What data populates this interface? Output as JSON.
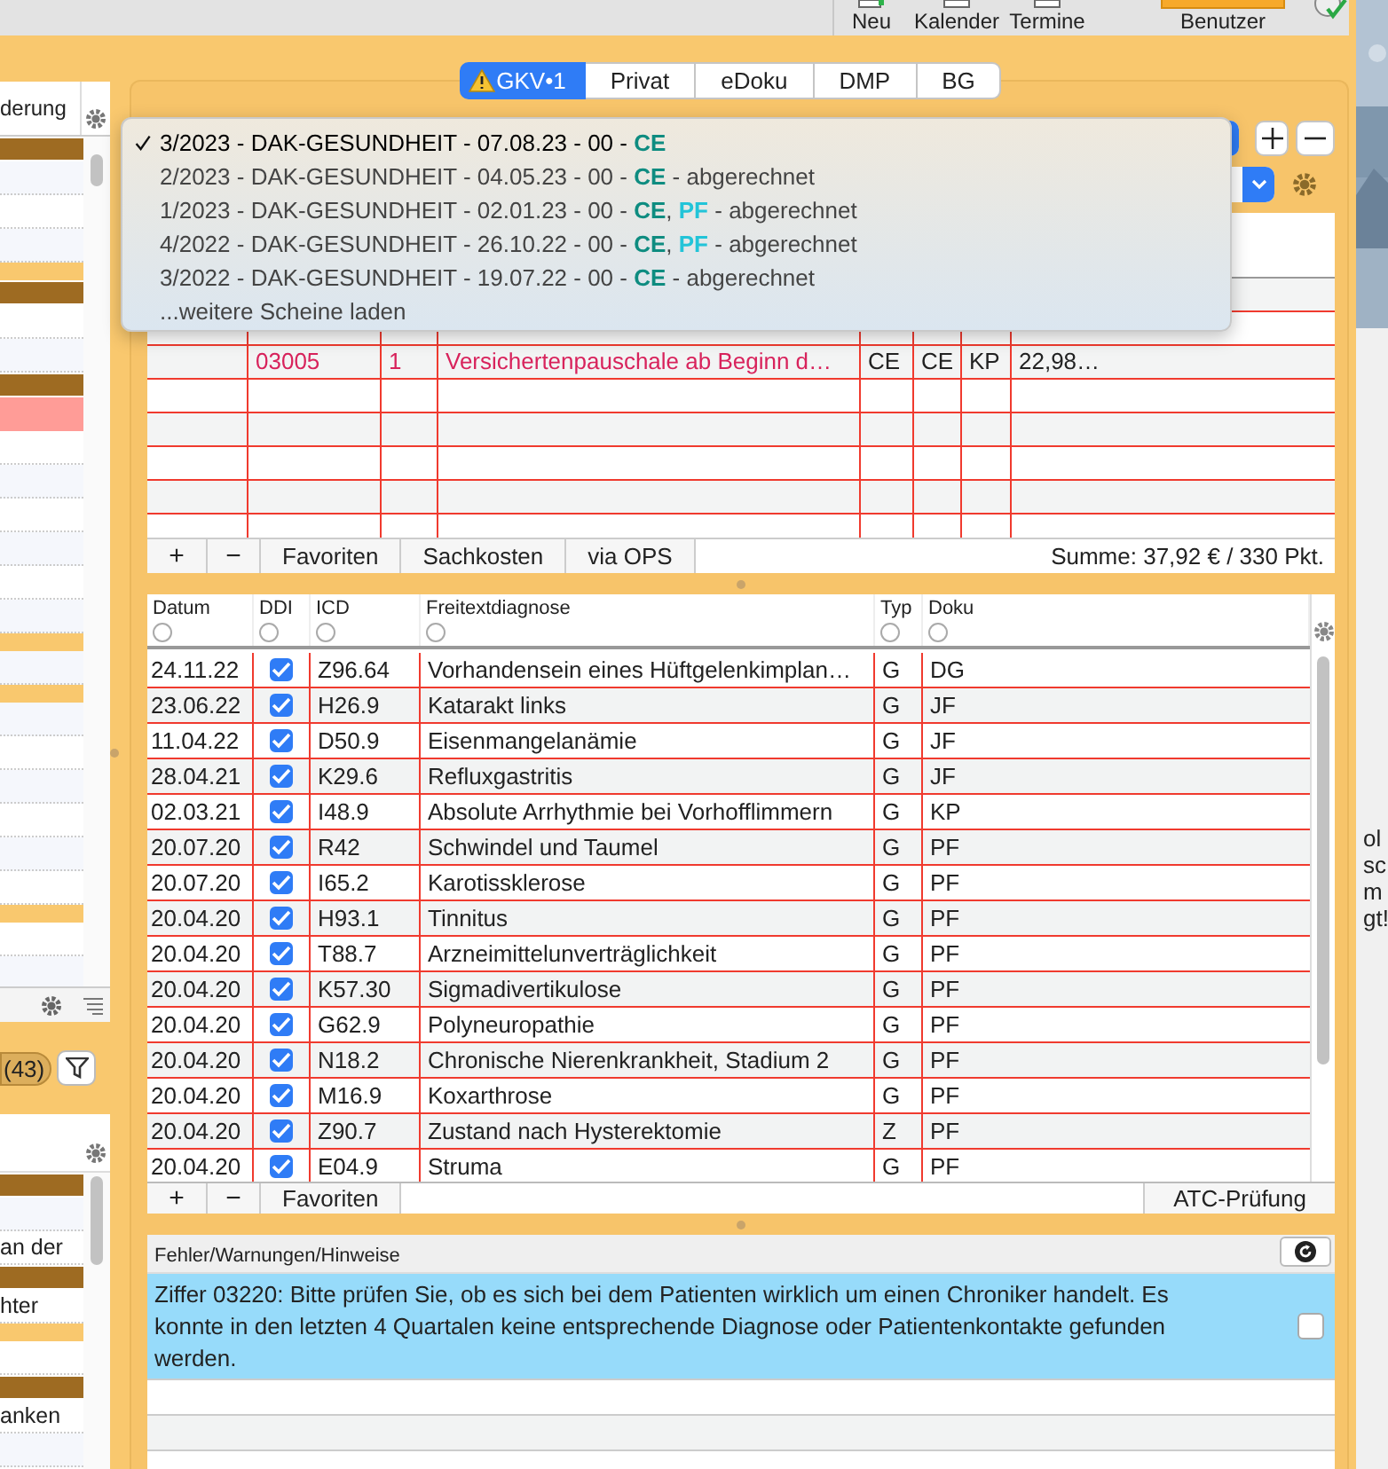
{
  "toolbar": {
    "items": [
      {
        "label": "Neu",
        "kind": "new"
      },
      {
        "label": "Kalender",
        "kind": "calendar"
      },
      {
        "label": "Termine",
        "kind": "appointments"
      },
      {
        "label": "Benutzer",
        "kind": "user"
      }
    ]
  },
  "left_panel": {
    "header": "derung",
    "rows": [
      {
        "kind": "group"
      },
      {
        "kind": "row"
      },
      {
        "kind": "row"
      },
      {
        "kind": "row"
      },
      {
        "kind": "band"
      },
      {
        "kind": "group"
      },
      {
        "kind": "row"
      },
      {
        "kind": "row"
      },
      {
        "kind": "group"
      },
      {
        "kind": "highlight"
      },
      {
        "kind": "row"
      },
      {
        "kind": "row"
      },
      {
        "kind": "row"
      },
      {
        "kind": "row"
      },
      {
        "kind": "row"
      },
      {
        "kind": "row"
      },
      {
        "kind": "band"
      },
      {
        "kind": "row"
      },
      {
        "kind": "band"
      },
      {
        "kind": "row"
      },
      {
        "kind": "row"
      },
      {
        "kind": "row"
      },
      {
        "kind": "row"
      },
      {
        "kind": "row"
      },
      {
        "kind": "row"
      },
      {
        "kind": "band"
      },
      {
        "kind": "row"
      },
      {
        "kind": "row"
      }
    ]
  },
  "left_lower": {
    "count": "(43)",
    "rows": [
      {
        "kind": "group"
      },
      {
        "kind": "row"
      },
      {
        "kind": "row",
        "text": "an der"
      },
      {
        "kind": "group"
      },
      {
        "kind": "row",
        "text": "hter"
      },
      {
        "kind": "band"
      },
      {
        "kind": "row"
      },
      {
        "kind": "group"
      },
      {
        "kind": "row",
        "text": "anken"
      },
      {
        "kind": "row"
      }
    ]
  },
  "tabs": [
    {
      "label": "GKV•1",
      "selected": true,
      "warning": true
    },
    {
      "label": "Privat",
      "selected": false,
      "warning": false
    },
    {
      "label": "eDoku",
      "selected": false,
      "warning": false
    },
    {
      "label": "DMP",
      "selected": false,
      "warning": false
    },
    {
      "label": "BG",
      "selected": false,
      "warning": false
    }
  ],
  "scheine_menu": {
    "items": [
      {
        "selected": true,
        "parts": [
          {
            "text": "3/2023 - DAK-GESUNDHEIT - 07.08.23 - 00 - "
          },
          {
            "text": "CE",
            "color": "#0e8c80"
          }
        ]
      },
      {
        "selected": false,
        "parts": [
          {
            "text": "2/2023 - DAK-GESUNDHEIT - 04.05.23 - 00 - "
          },
          {
            "text": "CE",
            "color": "#0e8c80"
          },
          {
            "text": " - abgerechnet"
          }
        ]
      },
      {
        "selected": false,
        "parts": [
          {
            "text": "1/2023 - DAK-GESUNDHEIT - 02.01.23 - 00 - "
          },
          {
            "text": "CE",
            "color": "#0e8c80"
          },
          {
            "text": ", "
          },
          {
            "text": "PF",
            "color": "#22c4d8"
          },
          {
            "text": " - abgerechnet"
          }
        ]
      },
      {
        "selected": false,
        "parts": [
          {
            "text": "4/2022 - DAK-GESUNDHEIT - 26.10.22 - 00 - "
          },
          {
            "text": "CE",
            "color": "#0e8c80"
          },
          {
            "text": ", "
          },
          {
            "text": "PF",
            "color": "#22c4d8"
          },
          {
            "text": " - abgerechnet"
          }
        ]
      },
      {
        "selected": false,
        "parts": [
          {
            "text": "3/2022 - DAK-GESUNDHEIT - 19.07.22 - 00 - "
          },
          {
            "text": "CE",
            "color": "#0e8c80"
          },
          {
            "text": " - abgerechnet"
          }
        ]
      }
    ],
    "more": "...weitere Scheine laden"
  },
  "leistungen": {
    "rows": [
      {
        "highlight": true,
        "cells": [
          "03005",
          "1",
          "Versichertenpauschale ab Beginn d…",
          "CE",
          "CE",
          "KP",
          "22,98…"
        ]
      }
    ],
    "footer": {
      "buttons": [
        "+",
        "−",
        "Favoriten",
        "Sachkosten",
        "via OPS"
      ],
      "sum": "Summe: 37,92 € / 330 Pkt."
    }
  },
  "diagnosen": {
    "columns": [
      "Datum",
      "DDI",
      "ICD",
      "Freitextdiagnose",
      "Typ",
      "Doku"
    ],
    "rows": [
      {
        "date": "24.11.22",
        "ddi": true,
        "icd": "Z96.64",
        "text": "Vorhandensein eines Hüftgelenkimplan…",
        "typ": "G",
        "doku": "DG"
      },
      {
        "date": "23.06.22",
        "ddi": true,
        "icd": "H26.9",
        "text": "Katarakt links",
        "typ": "G",
        "doku": "JF"
      },
      {
        "date": "11.04.22",
        "ddi": true,
        "icd": "D50.9",
        "text": "Eisenmangelanämie",
        "typ": "G",
        "doku": "JF"
      },
      {
        "date": "28.04.21",
        "ddi": true,
        "icd": "K29.6",
        "text": "Refluxgastritis",
        "typ": "G",
        "doku": "JF"
      },
      {
        "date": "02.03.21",
        "ddi": true,
        "icd": "I48.9",
        "text": "Absolute Arrhythmie bei Vorhofflimmern",
        "typ": "G",
        "doku": "KP"
      },
      {
        "date": "20.07.20",
        "ddi": true,
        "icd": "R42",
        "text": "Schwindel und Taumel",
        "typ": "G",
        "doku": "PF"
      },
      {
        "date": "20.07.20",
        "ddi": true,
        "icd": "I65.2",
        "text": "Karotissklerose",
        "typ": "G",
        "doku": "PF"
      },
      {
        "date": "20.04.20",
        "ddi": true,
        "icd": "H93.1",
        "text": "Tinnitus",
        "typ": "G",
        "doku": "PF"
      },
      {
        "date": "20.04.20",
        "ddi": true,
        "icd": "T88.7",
        "text": "Arzneimittelunverträglichkeit",
        "typ": "G",
        "doku": "PF"
      },
      {
        "date": "20.04.20",
        "ddi": true,
        "icd": "K57.30",
        "text": "Sigmadivertikulose",
        "typ": "G",
        "doku": "PF"
      },
      {
        "date": "20.04.20",
        "ddi": true,
        "icd": "G62.9",
        "text": "Polyneuropathie",
        "typ": "G",
        "doku": "PF"
      },
      {
        "date": "20.04.20",
        "ddi": true,
        "icd": "N18.2",
        "text": "Chronische Nierenkrankheit, Stadium 2",
        "typ": "G",
        "doku": "PF"
      },
      {
        "date": "20.04.20",
        "ddi": true,
        "icd": "M16.9",
        "text": "Koxarthrose",
        "typ": "G",
        "doku": "PF"
      },
      {
        "date": "20.04.20",
        "ddi": true,
        "icd": "Z90.7",
        "text": "Zustand nach Hysterektomie",
        "typ": "Z",
        "doku": "PF"
      },
      {
        "date": "20.04.20",
        "ddi": true,
        "icd": "E04.9",
        "text": "Struma",
        "typ": "G",
        "doku": "PF"
      }
    ],
    "footer": {
      "buttons": [
        "+",
        "−",
        "Favoriten"
      ],
      "right": "ATC-Prüfung"
    }
  },
  "hinweise": {
    "title": "Fehler/Warnungen/Hinweise",
    "messages": [
      {
        "text": "Ziffer 03220: Bitte prüfen Sie, ob es sich bei dem Patienten wirklich um einen Chroniker handelt. Es konnte in den letzten 4 Quartalen keine entsprechende Diagnose oder Patientenkontakte gefunden werden.",
        "checked": false
      }
    ]
  },
  "side_window": {
    "texts": [
      "ol",
      "sc",
      "m",
      "gt!"
    ]
  }
}
